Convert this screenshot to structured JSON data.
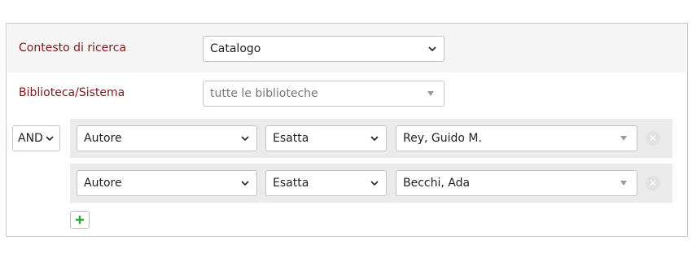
{
  "form": {
    "context_label": "Contesto di ricerca",
    "context_value": "Catalogo",
    "library_label": "Biblioteca/Sistema",
    "library_value": "tutte le biblioteche",
    "operator_value": "AND",
    "clauses": [
      {
        "field": "Autore",
        "match": "Esatta",
        "value": "Rey, Guido M."
      },
      {
        "field": "Autore",
        "match": "Esatta",
        "value": "Becchi, Ada"
      }
    ]
  },
  "icons": {
    "dropdown": "chevron-down-icon",
    "combo": "triangle-down-icon",
    "remove": "close-icon",
    "add": "plus-icon"
  },
  "colors": {
    "label_text": "#7a1a1a",
    "add_icon": "#2eaa3a",
    "remove_icon_bg": "#e2e2e2",
    "band_bg": "#f5f5f5",
    "clause_bg": "#ebebeb"
  }
}
